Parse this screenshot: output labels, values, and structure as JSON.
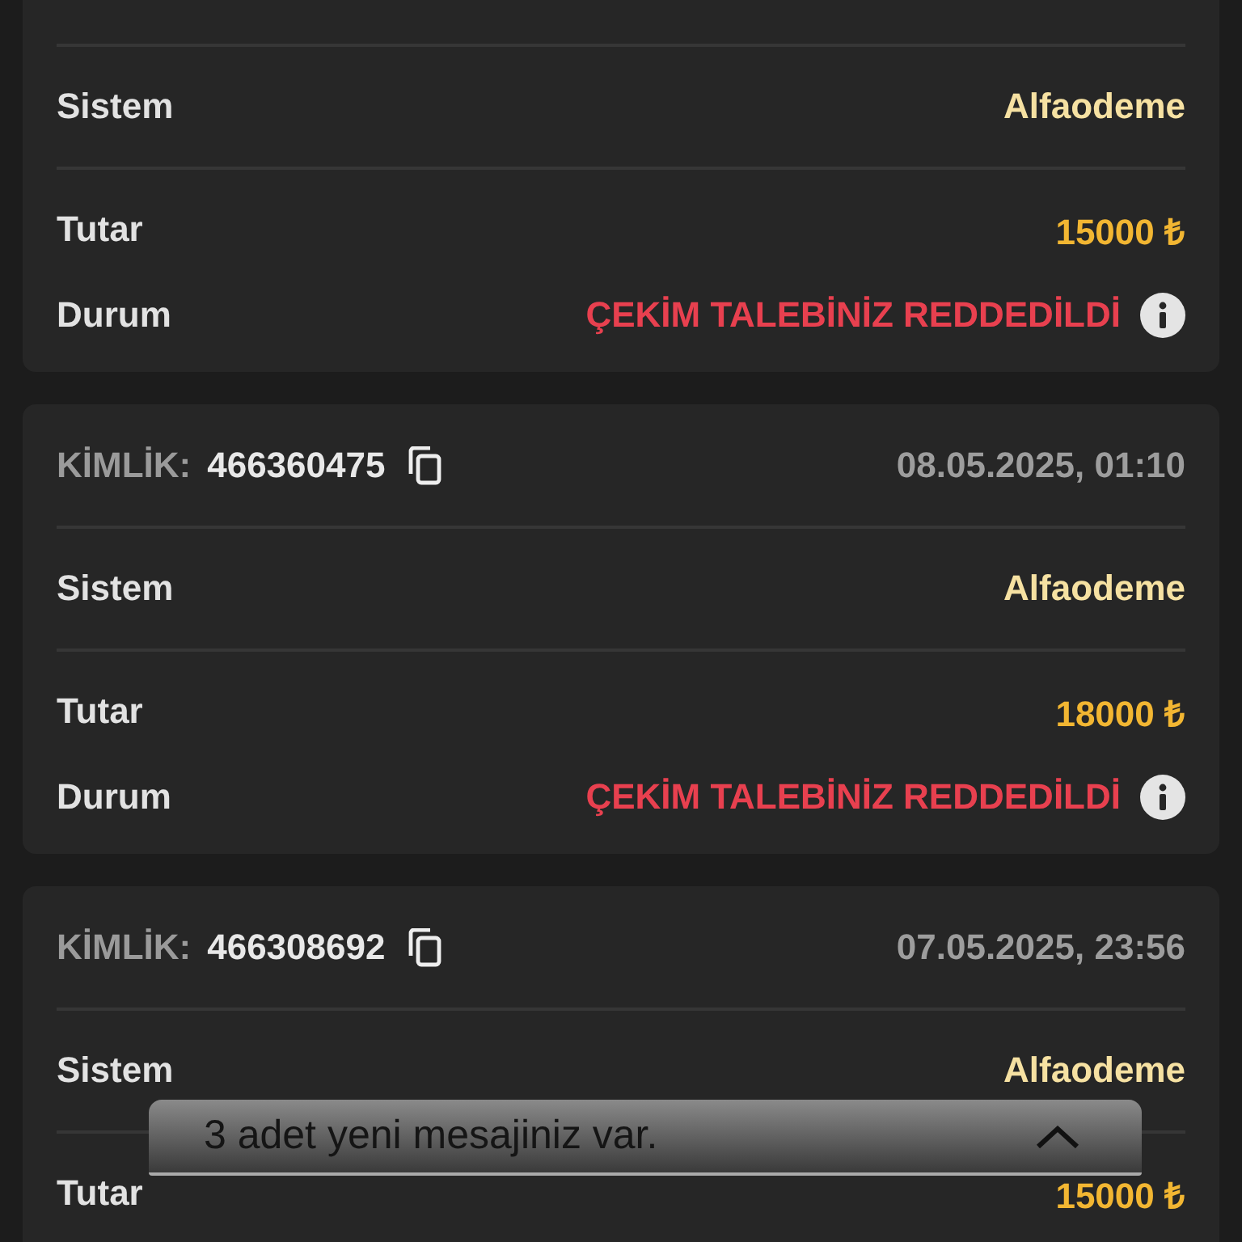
{
  "transactions": [
    {
      "rows": [
        {
          "kind": "system",
          "label": "Sistem",
          "value": "Alfaodeme"
        },
        {
          "kind": "amount",
          "label": "Tutar",
          "value": "15000 ₺"
        },
        {
          "kind": "status",
          "label": "Durum",
          "value": "ÇEKİM TALEBİNİZ REDDEDİLDİ"
        }
      ]
    },
    {
      "id_label": "KİMLİK:",
      "id": "466360475",
      "date": "08.05.2025, 01:10",
      "rows": [
        {
          "kind": "system",
          "label": "Sistem",
          "value": "Alfaodeme"
        },
        {
          "kind": "amount",
          "label": "Tutar",
          "value": "18000 ₺"
        },
        {
          "kind": "status",
          "label": "Durum",
          "value": "ÇEKİM TALEBİNİZ REDDEDİLDİ"
        }
      ]
    },
    {
      "id_label": "KİMLİK:",
      "id": "466308692",
      "date": "07.05.2025, 23:56",
      "rows": [
        {
          "kind": "system",
          "label": "Sistem",
          "value": "Alfaodeme"
        },
        {
          "kind": "amount",
          "label": "Tutar",
          "value": "15000 ₺"
        }
      ]
    }
  ],
  "toast": {
    "message": "3 adet yeni mesajiniz var."
  }
}
